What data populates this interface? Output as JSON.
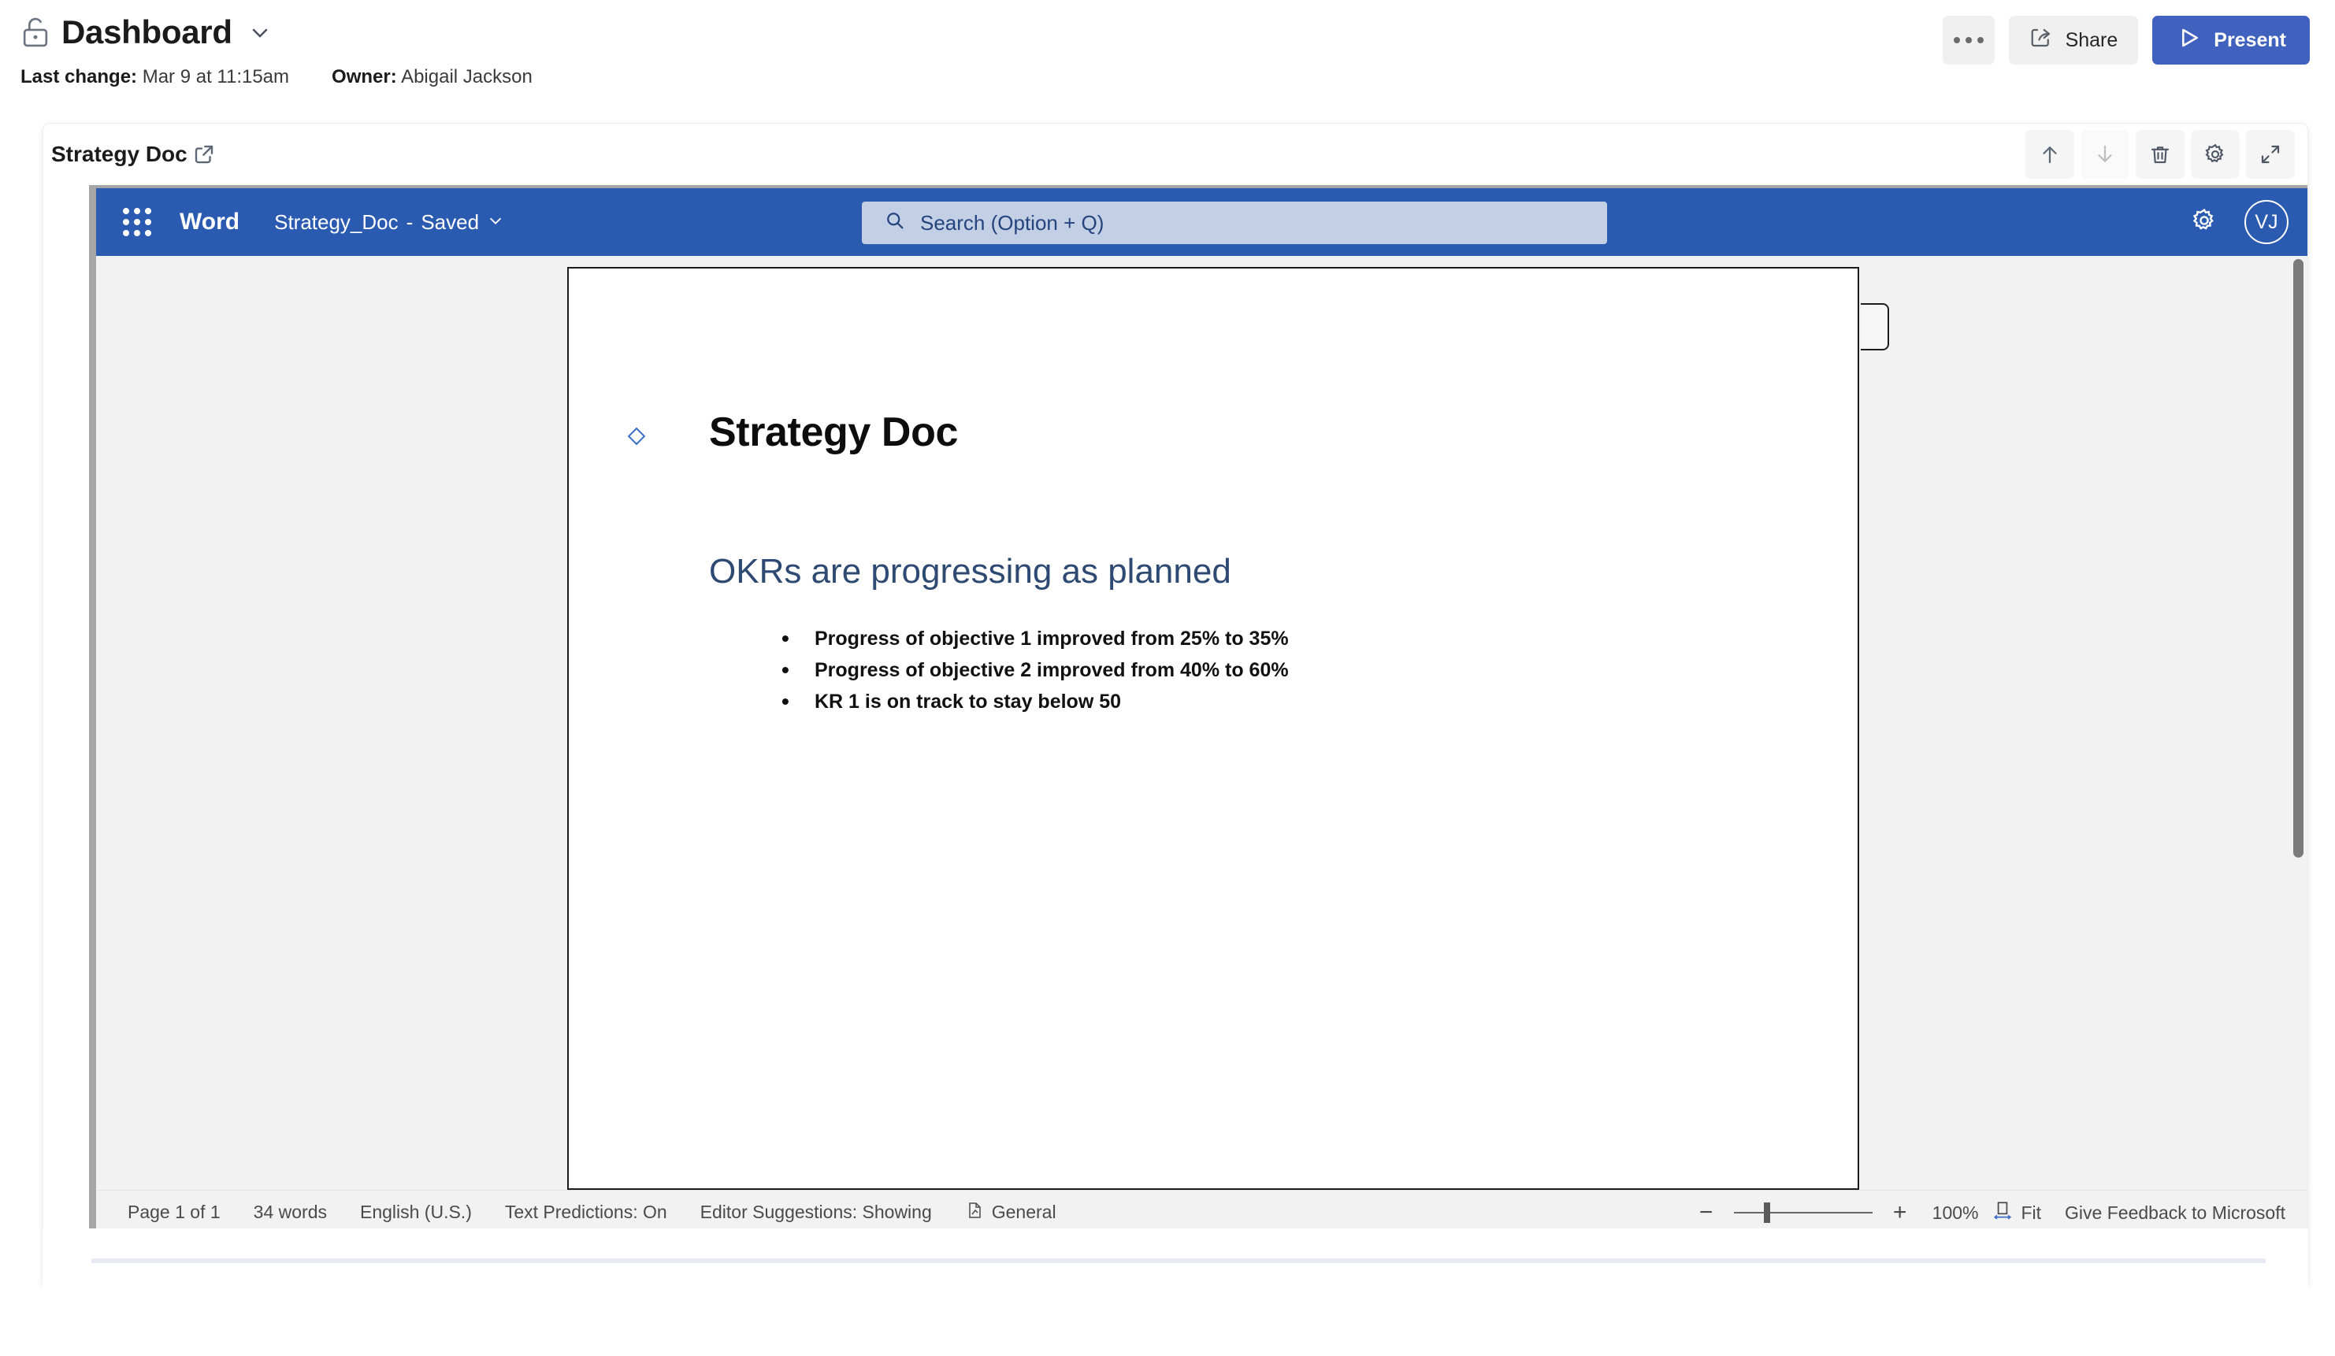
{
  "header": {
    "lock_icon": "unlock-icon",
    "title": "Dashboard",
    "chevron_icon": "chevron-down-icon",
    "last_change_label": "Last change:",
    "last_change_value": "Mar 9 at 11:15am",
    "owner_label": "Owner:",
    "owner_value": "Abigail Jackson",
    "more_icon": "ellipsis-icon",
    "share_label": "Share",
    "share_icon": "share-icon",
    "present_label": "Present",
    "present_icon": "play-icon",
    "present_color": "#4062be"
  },
  "widget": {
    "title": "Strategy Doc",
    "open_icon": "external-link-icon",
    "tools": [
      {
        "name": "move-up-button",
        "icon": "arrow-up-icon",
        "disabled": false
      },
      {
        "name": "move-down-button",
        "icon": "arrow-down-icon",
        "disabled": true
      },
      {
        "name": "delete-button",
        "icon": "trash-icon",
        "disabled": false
      },
      {
        "name": "settings-button",
        "icon": "gear-icon",
        "disabled": false
      },
      {
        "name": "expand-button",
        "icon": "expand-diagonal-icon",
        "disabled": false
      }
    ]
  },
  "word": {
    "accent_color": "#2b5bb0",
    "waffle_icon": "app-launcher-icon",
    "brand": "Word",
    "doc_name": "Strategy_Doc",
    "save_separator": "-",
    "save_state": "Saved",
    "doc_chevron_icon": "chevron-down-icon",
    "search_icon": "search-icon",
    "search_placeholder": "Search (Option + Q)",
    "search_value": "",
    "settings_icon": "gear-icon",
    "avatar_initials": "VJ",
    "document": {
      "marker_icon": "diamond-marker-icon",
      "title": "Strategy Doc",
      "heading": "OKRs are progressing as planned",
      "heading_color": "#2e4a73",
      "bullets": [
        "Progress of objective 1 improved from 25% to 35%",
        "Progress of objective 2 improved from 40% to 60%",
        "KR 1 is on track to stay below 50"
      ]
    },
    "status": {
      "page": "Page 1 of 1",
      "words": "34 words",
      "language": "English (U.S.)",
      "text_predictions": "Text Predictions: On",
      "editor_suggestions": "Editor Suggestions: Showing",
      "style_icon": "document-style-icon",
      "style": "General",
      "zoom_out_icon": "minus-icon",
      "zoom_in_icon": "plus-icon",
      "zoom_level": "100%",
      "fit_icon": "fit-page-icon",
      "fit_label": "Fit",
      "feedback": "Give Feedback to Microsoft"
    }
  }
}
